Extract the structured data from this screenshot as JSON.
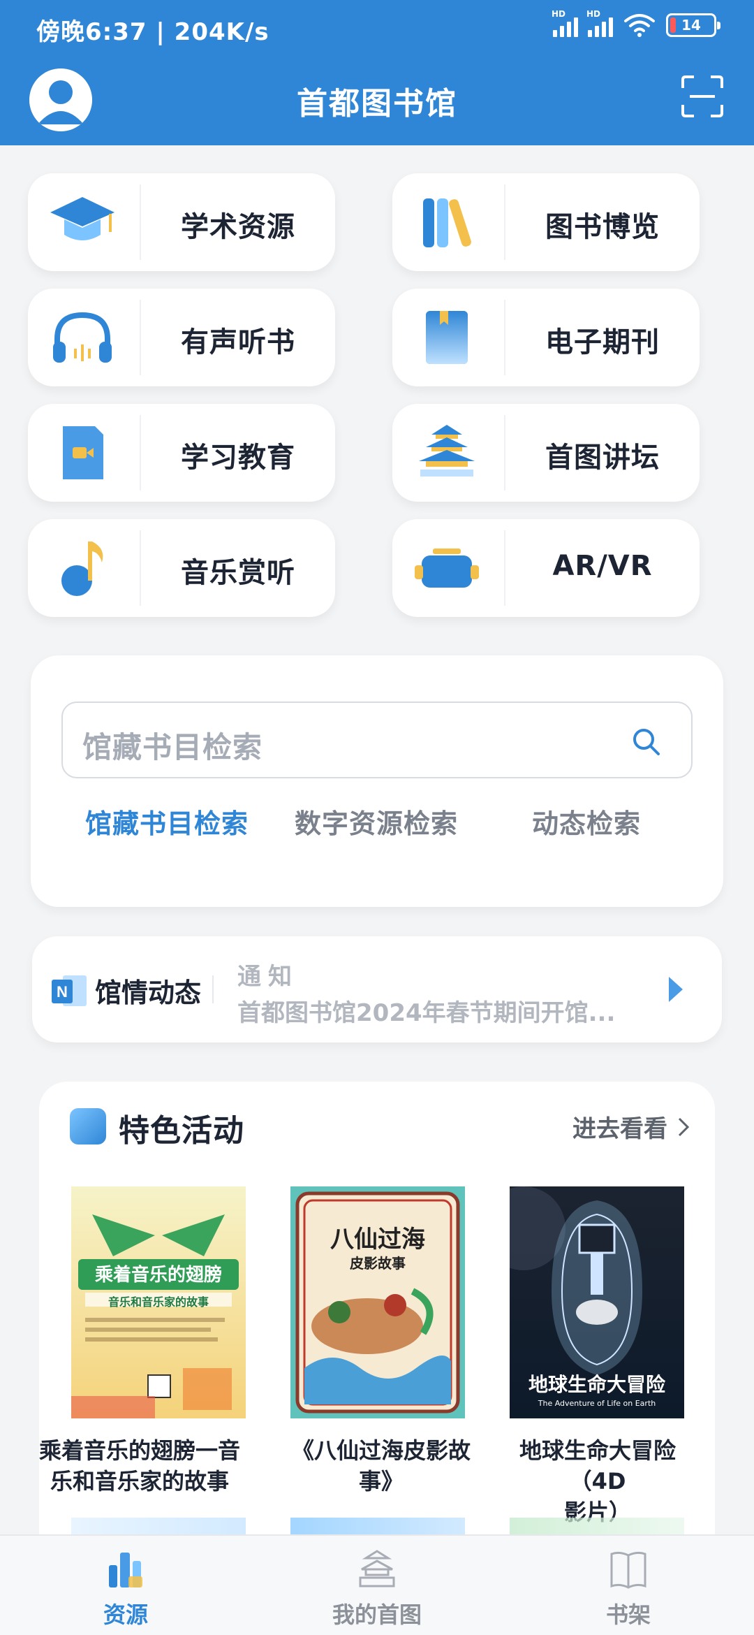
{
  "status_bar": {
    "left_text": "傍晚6:37 | 204K/s",
    "signal_badge": "HD",
    "battery_level": "14"
  },
  "header": {
    "title": "首都图书馆",
    "avatar_icon": "user-avatar-icon",
    "scan_icon": "scan-icon"
  },
  "features": [
    {
      "label": "学术资源",
      "icon": "graduation-cap-icon"
    },
    {
      "label": "图书博览",
      "icon": "books-icon"
    },
    {
      "label": "有声听书",
      "icon": "headphones-icon"
    },
    {
      "label": "电子期刊",
      "icon": "magazine-icon"
    },
    {
      "label": "学习教育",
      "icon": "video-file-icon"
    },
    {
      "label": "首图讲坛",
      "icon": "temple-icon"
    },
    {
      "label": "音乐赏听",
      "icon": "music-note-icon"
    },
    {
      "label": "AR/VR",
      "icon": "vr-headset-icon"
    }
  ],
  "search": {
    "placeholder": "馆藏书目检索",
    "tabs": [
      {
        "label": "馆藏书目检索",
        "active": true
      },
      {
        "label": "数字资源检索",
        "active": false
      },
      {
        "label": "动态检索",
        "active": false
      }
    ]
  },
  "news": {
    "title": "馆情动态",
    "category": "通知",
    "headline": "首都图书馆2024年春节期间开馆..."
  },
  "activities": {
    "title": "特色活动",
    "more": "进去看看",
    "items": [
      {
        "title_line1": "乘着音乐的翅膀一音",
        "title_line2": "乐和音乐家的故事",
        "poster_heading": "乘着音乐的翅膀",
        "poster_sub": "音乐和音乐家的故事"
      },
      {
        "title_line1": "《八仙过海皮影故",
        "title_line2": "事》",
        "poster_heading": "八仙过海",
        "poster_sub": "皮影故事"
      },
      {
        "title_line1": "地球生命大冒险（4D",
        "title_line2": "影片）",
        "poster_heading": "地球生命大冒险",
        "poster_sub": "The Adventure of Life on Earth"
      }
    ]
  },
  "tabbar": [
    {
      "label": "资源",
      "icon": "resources-icon",
      "active": true
    },
    {
      "label": "我的首图",
      "icon": "my-library-icon",
      "active": false
    },
    {
      "label": "书架",
      "icon": "bookshelf-icon",
      "active": false
    }
  ],
  "colors": {
    "primary": "#2f86d6",
    "background": "#f3f4f6",
    "text": "#1d2433",
    "muted": "#b2b7bf"
  }
}
